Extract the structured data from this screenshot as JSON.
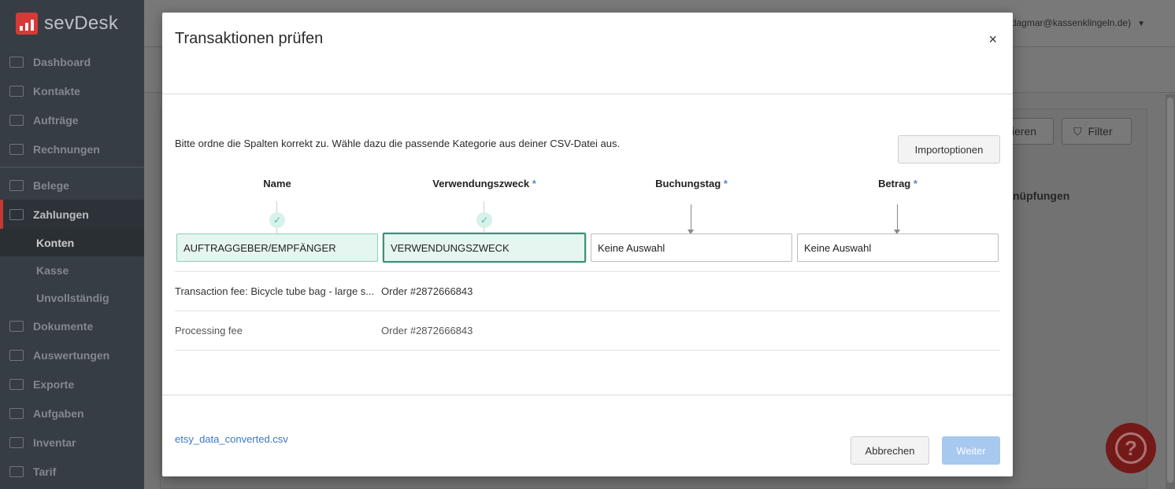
{
  "app": {
    "brand": "sevDesk",
    "user": "(dagmar@kassenklingeln.de)",
    "sidebar": [
      {
        "label": "Dashboard"
      },
      {
        "label": "Kontakte"
      },
      {
        "label": "Aufträge"
      },
      {
        "label": "Rechnungen"
      },
      {
        "label": "Belege"
      },
      {
        "label": "Zahlungen"
      },
      {
        "label": "Dokumente"
      },
      {
        "label": "Auswertungen"
      },
      {
        "label": "Exporte"
      },
      {
        "label": "Aufgaben"
      },
      {
        "label": "Inventar"
      },
      {
        "label": "Tarif"
      }
    ],
    "sidebar_sub": [
      {
        "label": "Konten"
      },
      {
        "label": "Kasse"
      },
      {
        "label": "Unvollständig"
      }
    ],
    "bg_buttons": {
      "export_partial": "tieren",
      "filter": "Filter"
    },
    "bg_column_header": "nüpfungen",
    "help_icon": "?"
  },
  "modal": {
    "title": "Transaktionen prüfen",
    "close_icon": "×",
    "instruction": "Bitte ordne die Spalten korrekt zu. Wähle dazu die passende Kategorie aus deiner CSV-Datei aus.",
    "import_options_label": "Importoptionen",
    "required_marker": "*",
    "columns": [
      {
        "header": "Name",
        "required": false,
        "selected": "AUFTRAGGEBER/EMPFÄNGER",
        "mapped": true
      },
      {
        "header": "Verwendungszweck",
        "required": true,
        "selected": "VERWENDUNGSZWECK",
        "mapped": true
      },
      {
        "header": "Buchungstag",
        "required": true,
        "selected": "Keine Auswahl",
        "mapped": false
      },
      {
        "header": "Betrag",
        "required": true,
        "selected": "Keine Auswahl",
        "mapped": false
      }
    ],
    "rows": [
      {
        "name": "Transaction fee: Bicycle tube bag - large s...",
        "purpose": "Order #2872666843"
      },
      {
        "name": "Processing fee",
        "purpose": "Order #2872666843"
      }
    ],
    "file_name": "etsy_data_converted.csv",
    "cancel_label": "Abbrechen",
    "next_label": "Weiter"
  }
}
